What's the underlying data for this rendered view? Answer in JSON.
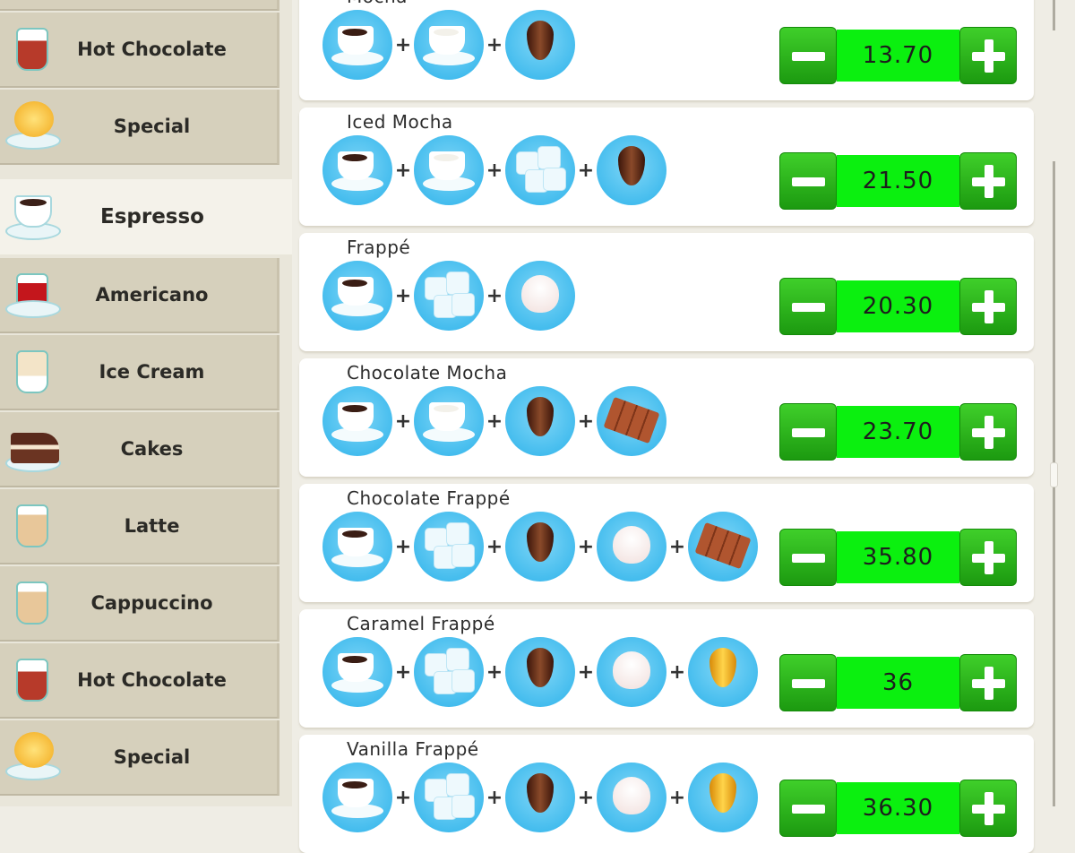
{
  "sidebar": {
    "items": [
      {
        "label": "Hot Chocolate",
        "icon": "hot-chocolate-icon",
        "selected": false
      },
      {
        "label": "Special",
        "icon": "special-icon",
        "selected": false
      },
      {
        "label": "Espresso",
        "icon": "espresso-icon",
        "selected": true
      },
      {
        "label": "Americano",
        "icon": "americano-icon",
        "selected": false
      },
      {
        "label": "Ice Cream",
        "icon": "ice-cream-icon",
        "selected": false
      },
      {
        "label": "Cakes",
        "icon": "cakes-icon",
        "selected": false
      },
      {
        "label": "Latte",
        "icon": "latte-icon",
        "selected": false
      },
      {
        "label": "Cappuccino",
        "icon": "cappuccino-icon",
        "selected": false
      },
      {
        "label": "Hot Chocolate",
        "icon": "hot-chocolate-icon",
        "selected": false
      },
      {
        "label": "Special",
        "icon": "special-icon",
        "selected": false
      }
    ]
  },
  "recipes": [
    {
      "name": "Mocha",
      "ingredients": [
        "espresso",
        "milk",
        "chocolate-syrup"
      ],
      "price": "13.70"
    },
    {
      "name": "Iced Mocha",
      "ingredients": [
        "espresso",
        "milk",
        "ice",
        "chocolate-syrup"
      ],
      "price": "21.50"
    },
    {
      "name": "Frappé",
      "ingredients": [
        "espresso",
        "ice",
        "whipped-cream"
      ],
      "price": "20.30"
    },
    {
      "name": "Chocolate Mocha",
      "ingredients": [
        "espresso",
        "milk",
        "chocolate-syrup",
        "chocolate-bar"
      ],
      "price": "23.70"
    },
    {
      "name": "Chocolate Frappé",
      "ingredients": [
        "espresso",
        "ice",
        "chocolate-syrup",
        "whipped-cream",
        "chocolate-bar"
      ],
      "price": "35.80"
    },
    {
      "name": "Caramel Frappé",
      "ingredients": [
        "espresso",
        "ice",
        "chocolate-syrup",
        "whipped-cream",
        "caramel-syrup"
      ],
      "price": "36"
    },
    {
      "name": "Vanilla Frappé",
      "ingredients": [
        "espresso",
        "ice",
        "chocolate-syrup",
        "whipped-cream",
        "caramel-syrup"
      ],
      "price": "36.30"
    }
  ],
  "plus_sign": "+",
  "colors": {
    "stepper_value_bg": "#0bf00f",
    "stepper_button": "#22a818",
    "ingredient_circle": "#2cb2ea",
    "sidebar_item": "#d6d0bc",
    "sidebar_selected": "#f4f2ea"
  }
}
